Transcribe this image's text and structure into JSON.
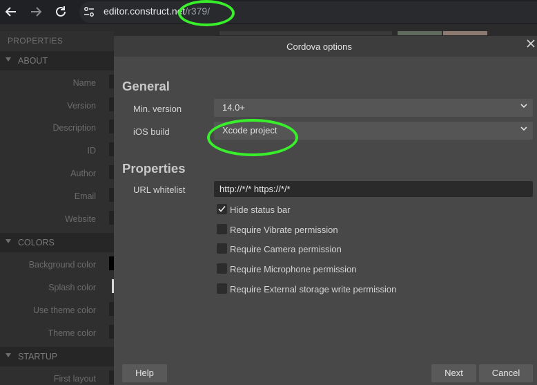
{
  "browser": {
    "url_host": "editor.construct.net",
    "url_path": "/r379/"
  },
  "panel": {
    "title": "PROPERTIES",
    "sections": [
      {
        "label": "ABOUT",
        "props": [
          "Name",
          "Version",
          "Description",
          "ID",
          "Author",
          "Email",
          "Website"
        ]
      },
      {
        "label": "COLORS",
        "props": [
          "Background color",
          "Splash color",
          "Use theme color",
          "Theme color"
        ]
      },
      {
        "label": "STARTUP",
        "props": [
          "First layout"
        ]
      }
    ]
  },
  "dialog": {
    "title": "Cordova options",
    "general_heading": "General",
    "min_version_label": "Min. version",
    "min_version_value": "14.0+",
    "ios_build_label": "iOS build",
    "ios_build_value": "Xcode project",
    "properties_heading": "Properties",
    "url_whitelist_label": "URL whitelist",
    "url_whitelist_value": "http://*/* https://*/*",
    "checkboxes": [
      {
        "label": "Hide status bar",
        "checked": true
      },
      {
        "label": "Require Vibrate permission",
        "checked": false
      },
      {
        "label": "Require Camera permission",
        "checked": false
      },
      {
        "label": "Require Microphone permission",
        "checked": false
      },
      {
        "label": "Require External storage write permission",
        "checked": false
      }
    ],
    "help_label": "Help",
    "next_label": "Next",
    "cancel_label": "Cancel"
  },
  "colors": {
    "annotation": "#39ef2c",
    "dialog_bg": "#484848",
    "titlebar_bg": "#3d3d3d"
  }
}
